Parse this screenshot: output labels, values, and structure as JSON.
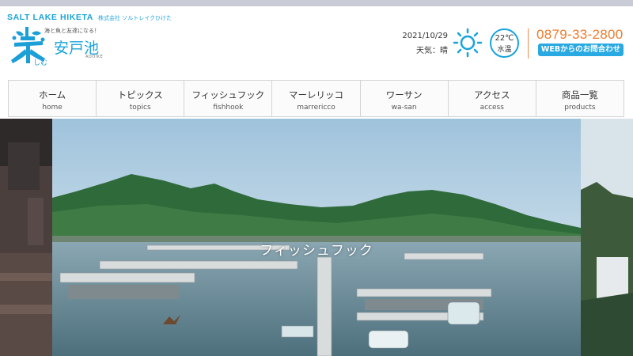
{
  "brand": {
    "name_en": "SALT LAKE HIKETA",
    "name_jp": "株式会社 ソルトレイクひけた"
  },
  "logo": {
    "tagline": "海と魚と友達になる！",
    "name": "安戸池",
    "roman": "ADOIKE",
    "icon": "raku-calligraphy-logo",
    "accent": "#1aa3d8"
  },
  "weather": {
    "date": "2021/10/29",
    "condition": "天気：晴",
    "icon": "sun-icon",
    "temperature": "22℃",
    "temperature_label": "水温"
  },
  "contact": {
    "phone": "0879-33-2800",
    "web_button": "WEBからのお問合わせ",
    "phone_color": "#ee7b2c",
    "button_color": "#29a9e1"
  },
  "nav": {
    "items": [
      {
        "jp": "ホーム",
        "en": "home"
      },
      {
        "jp": "トピックス",
        "en": "topics"
      },
      {
        "jp": "フィッシュフック",
        "en": "fishhook"
      },
      {
        "jp": "マーレリッコ",
        "en": "marrericco"
      },
      {
        "jp": "ワーサン",
        "en": "wa-san"
      },
      {
        "jp": "アクセス",
        "en": "access"
      },
      {
        "jp": "商品一覧",
        "en": "products"
      }
    ]
  },
  "hero": {
    "caption": "フィッシュフック"
  }
}
